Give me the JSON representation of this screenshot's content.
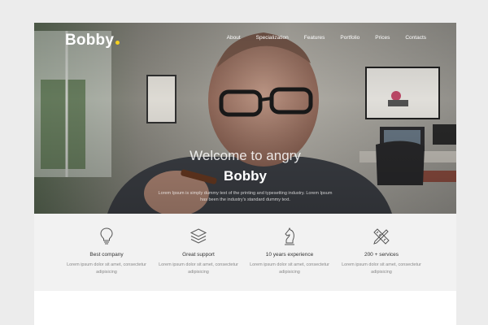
{
  "brand": {
    "name": "Bobby",
    "dot_color": "#f5d020"
  },
  "nav": {
    "items": [
      {
        "label": "About"
      },
      {
        "label": "Specialization"
      },
      {
        "label": "Features"
      },
      {
        "label": "Portfolio"
      },
      {
        "label": "Prices"
      },
      {
        "label": "Contacts"
      }
    ]
  },
  "hero": {
    "title": "Welcome to angry",
    "name": "Bobby",
    "subtitle": "Lorem Ipsum is simply dummy text of the printing and typesetting industry. Lorem Ipsum has been the industry's standard dummy text."
  },
  "features": [
    {
      "icon": "lightbulb-icon",
      "title": "Best company",
      "text": "Lorem ipsum dolor sit amet, consectetur adipisicing"
    },
    {
      "icon": "layers-icon",
      "title": "Great support",
      "text": "Lorem ipsum dolor sit amet, consectetur adipisicing"
    },
    {
      "icon": "chess-knight-icon",
      "title": "10 years experience",
      "text": "Lorem ipsum dolor sit amet, consectetur adipisicing"
    },
    {
      "icon": "pencil-ruler-icon",
      "title": "200 + services",
      "text": "Lorem ipsum dolor sit amet, consectetur adipisicing"
    }
  ]
}
